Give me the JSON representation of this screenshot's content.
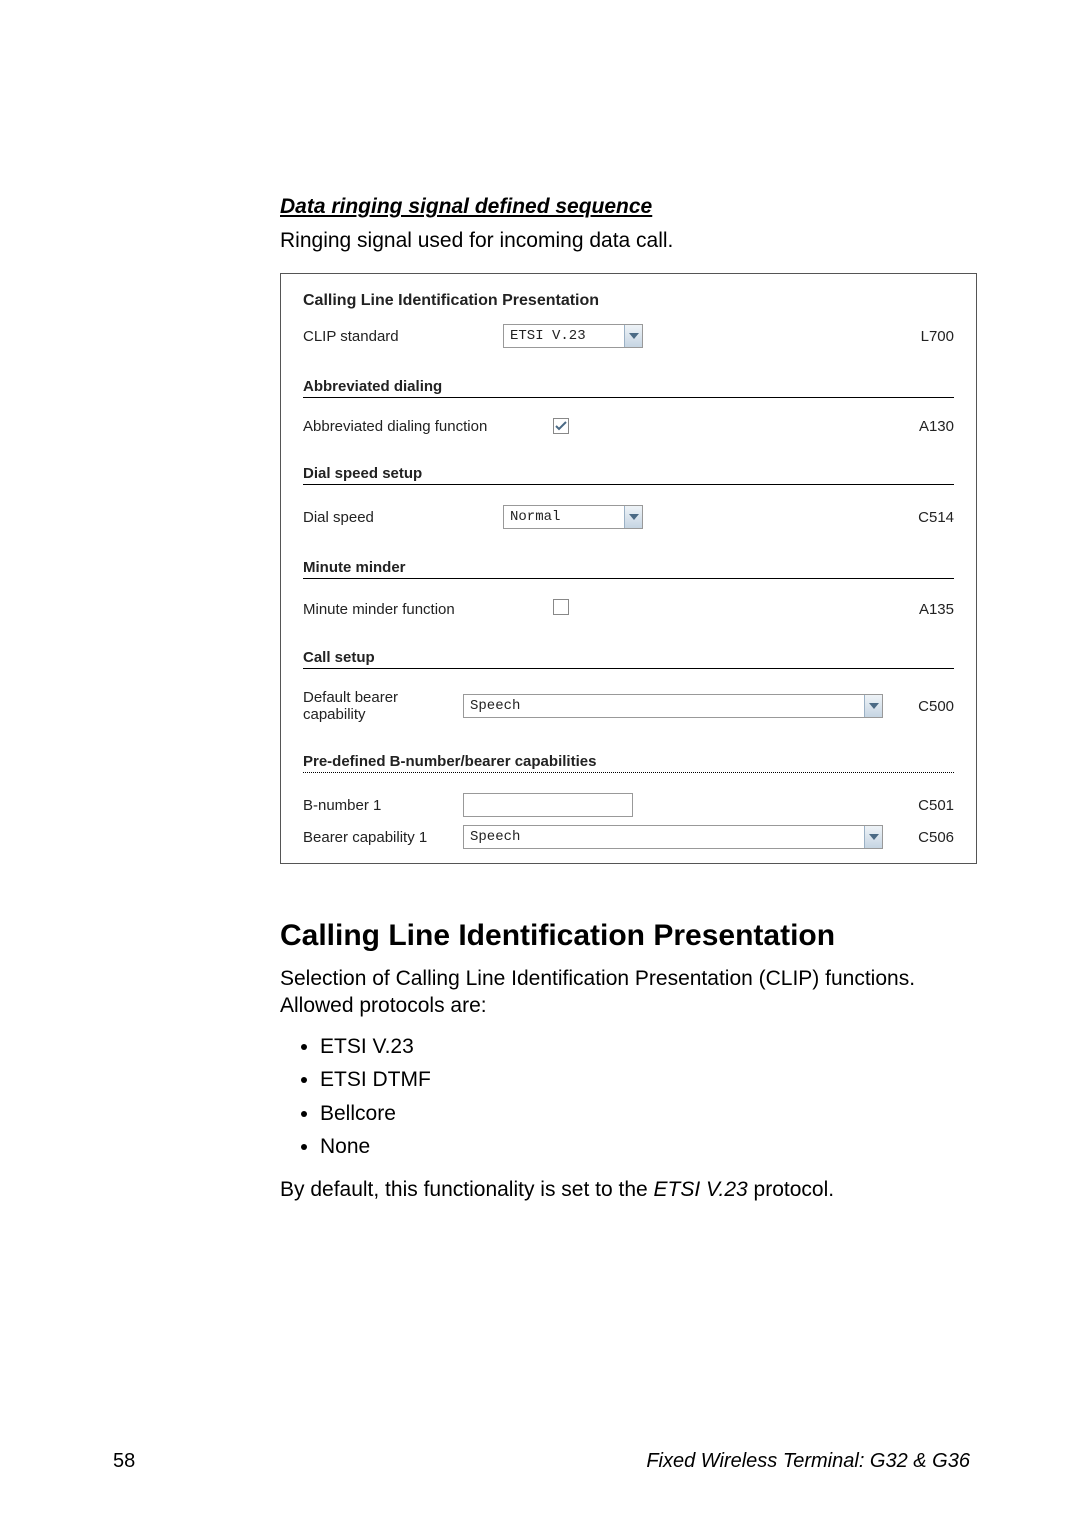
{
  "section": {
    "title": "Data ringing signal defined sequence",
    "desc": "Ringing signal used for incoming data call."
  },
  "form": {
    "title": "Calling Line Identification Presentation",
    "clip": {
      "label": "CLIP standard",
      "value": "ETSI V.23",
      "code": "L700"
    },
    "abbrev_head": "Abbreviated dialing",
    "abbrev": {
      "label": "Abbreviated dialing function",
      "checked": true,
      "code": "A130"
    },
    "dialspeed_head": "Dial speed setup",
    "dialspeed": {
      "label": "Dial speed",
      "value": "Normal",
      "code": "C514"
    },
    "minute_head": "Minute minder",
    "minute": {
      "label": "Minute minder function",
      "checked": false,
      "code": "A135"
    },
    "callsetup_head": "Call setup",
    "bearer": {
      "label": "Default bearer capability",
      "value": "Speech",
      "code": "C500"
    },
    "predef_head": "Pre-defined B-number/bearer capabilities",
    "bnum": {
      "label": "B-number 1",
      "value": "",
      "code": "C501"
    },
    "bcap": {
      "label": "Bearer capability 1",
      "value": "Speech",
      "code": "C506"
    }
  },
  "heading2": "Calling Line Identification Presentation",
  "para1": "Selection of Calling Line Identification Presentation (CLIP) functions. Allowed protocols are:",
  "protocols": [
    "ETSI V.23",
    "ETSI DTMF",
    "Bellcore",
    "None"
  ],
  "para2_pre": "By default, this functionality is set to the ",
  "para2_em": "ETSI V.23",
  "para2_post": " protocol.",
  "footer": {
    "page": "58",
    "doc": "Fixed Wireless Terminal: G32 & G36"
  }
}
